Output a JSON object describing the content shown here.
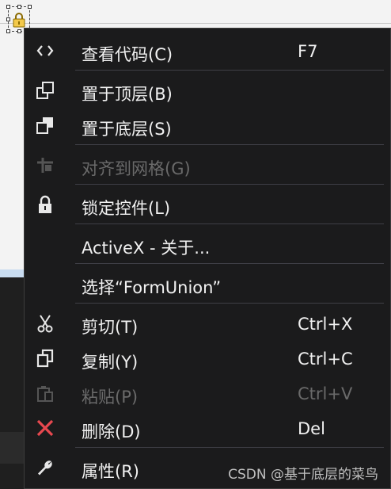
{
  "context_menu": {
    "items": [
      {
        "label": "查看代码(C)",
        "shortcut": "F7",
        "icon": "code-icon"
      },
      {
        "label": "置于顶层(B)",
        "icon": "bring-to-front-icon"
      },
      {
        "label": "置于底层(S)",
        "icon": "send-to-back-icon"
      },
      {
        "label": "对齐到网格(G)",
        "icon": "align-to-grid-icon",
        "disabled": true
      },
      {
        "label": "锁定控件(L)",
        "icon": "lock-icon"
      },
      {
        "label": "ActiveX  -  关于..."
      },
      {
        "label": "选择“FormUnion”"
      },
      {
        "label": "剪切(T)",
        "shortcut": "Ctrl+X",
        "icon": "cut-icon"
      },
      {
        "label": "复制(Y)",
        "shortcut": "Ctrl+C",
        "icon": "copy-icon"
      },
      {
        "label": "粘贴(P)",
        "shortcut": "Ctrl+V",
        "icon": "paste-icon",
        "disabled": true
      },
      {
        "label": "删除(D)",
        "shortcut": "Del",
        "icon": "delete-icon"
      },
      {
        "label": "属性(R)",
        "icon": "wrench-icon"
      }
    ]
  },
  "watermark": "CSDN @基于底层的菜鸟",
  "colors": {
    "menu_background": "#1b1b1c",
    "menu_text": "#f1f1f1",
    "disabled_text": "#6a6a6a",
    "delete_icon": "#e8484f",
    "separator": "#3f3f46"
  }
}
